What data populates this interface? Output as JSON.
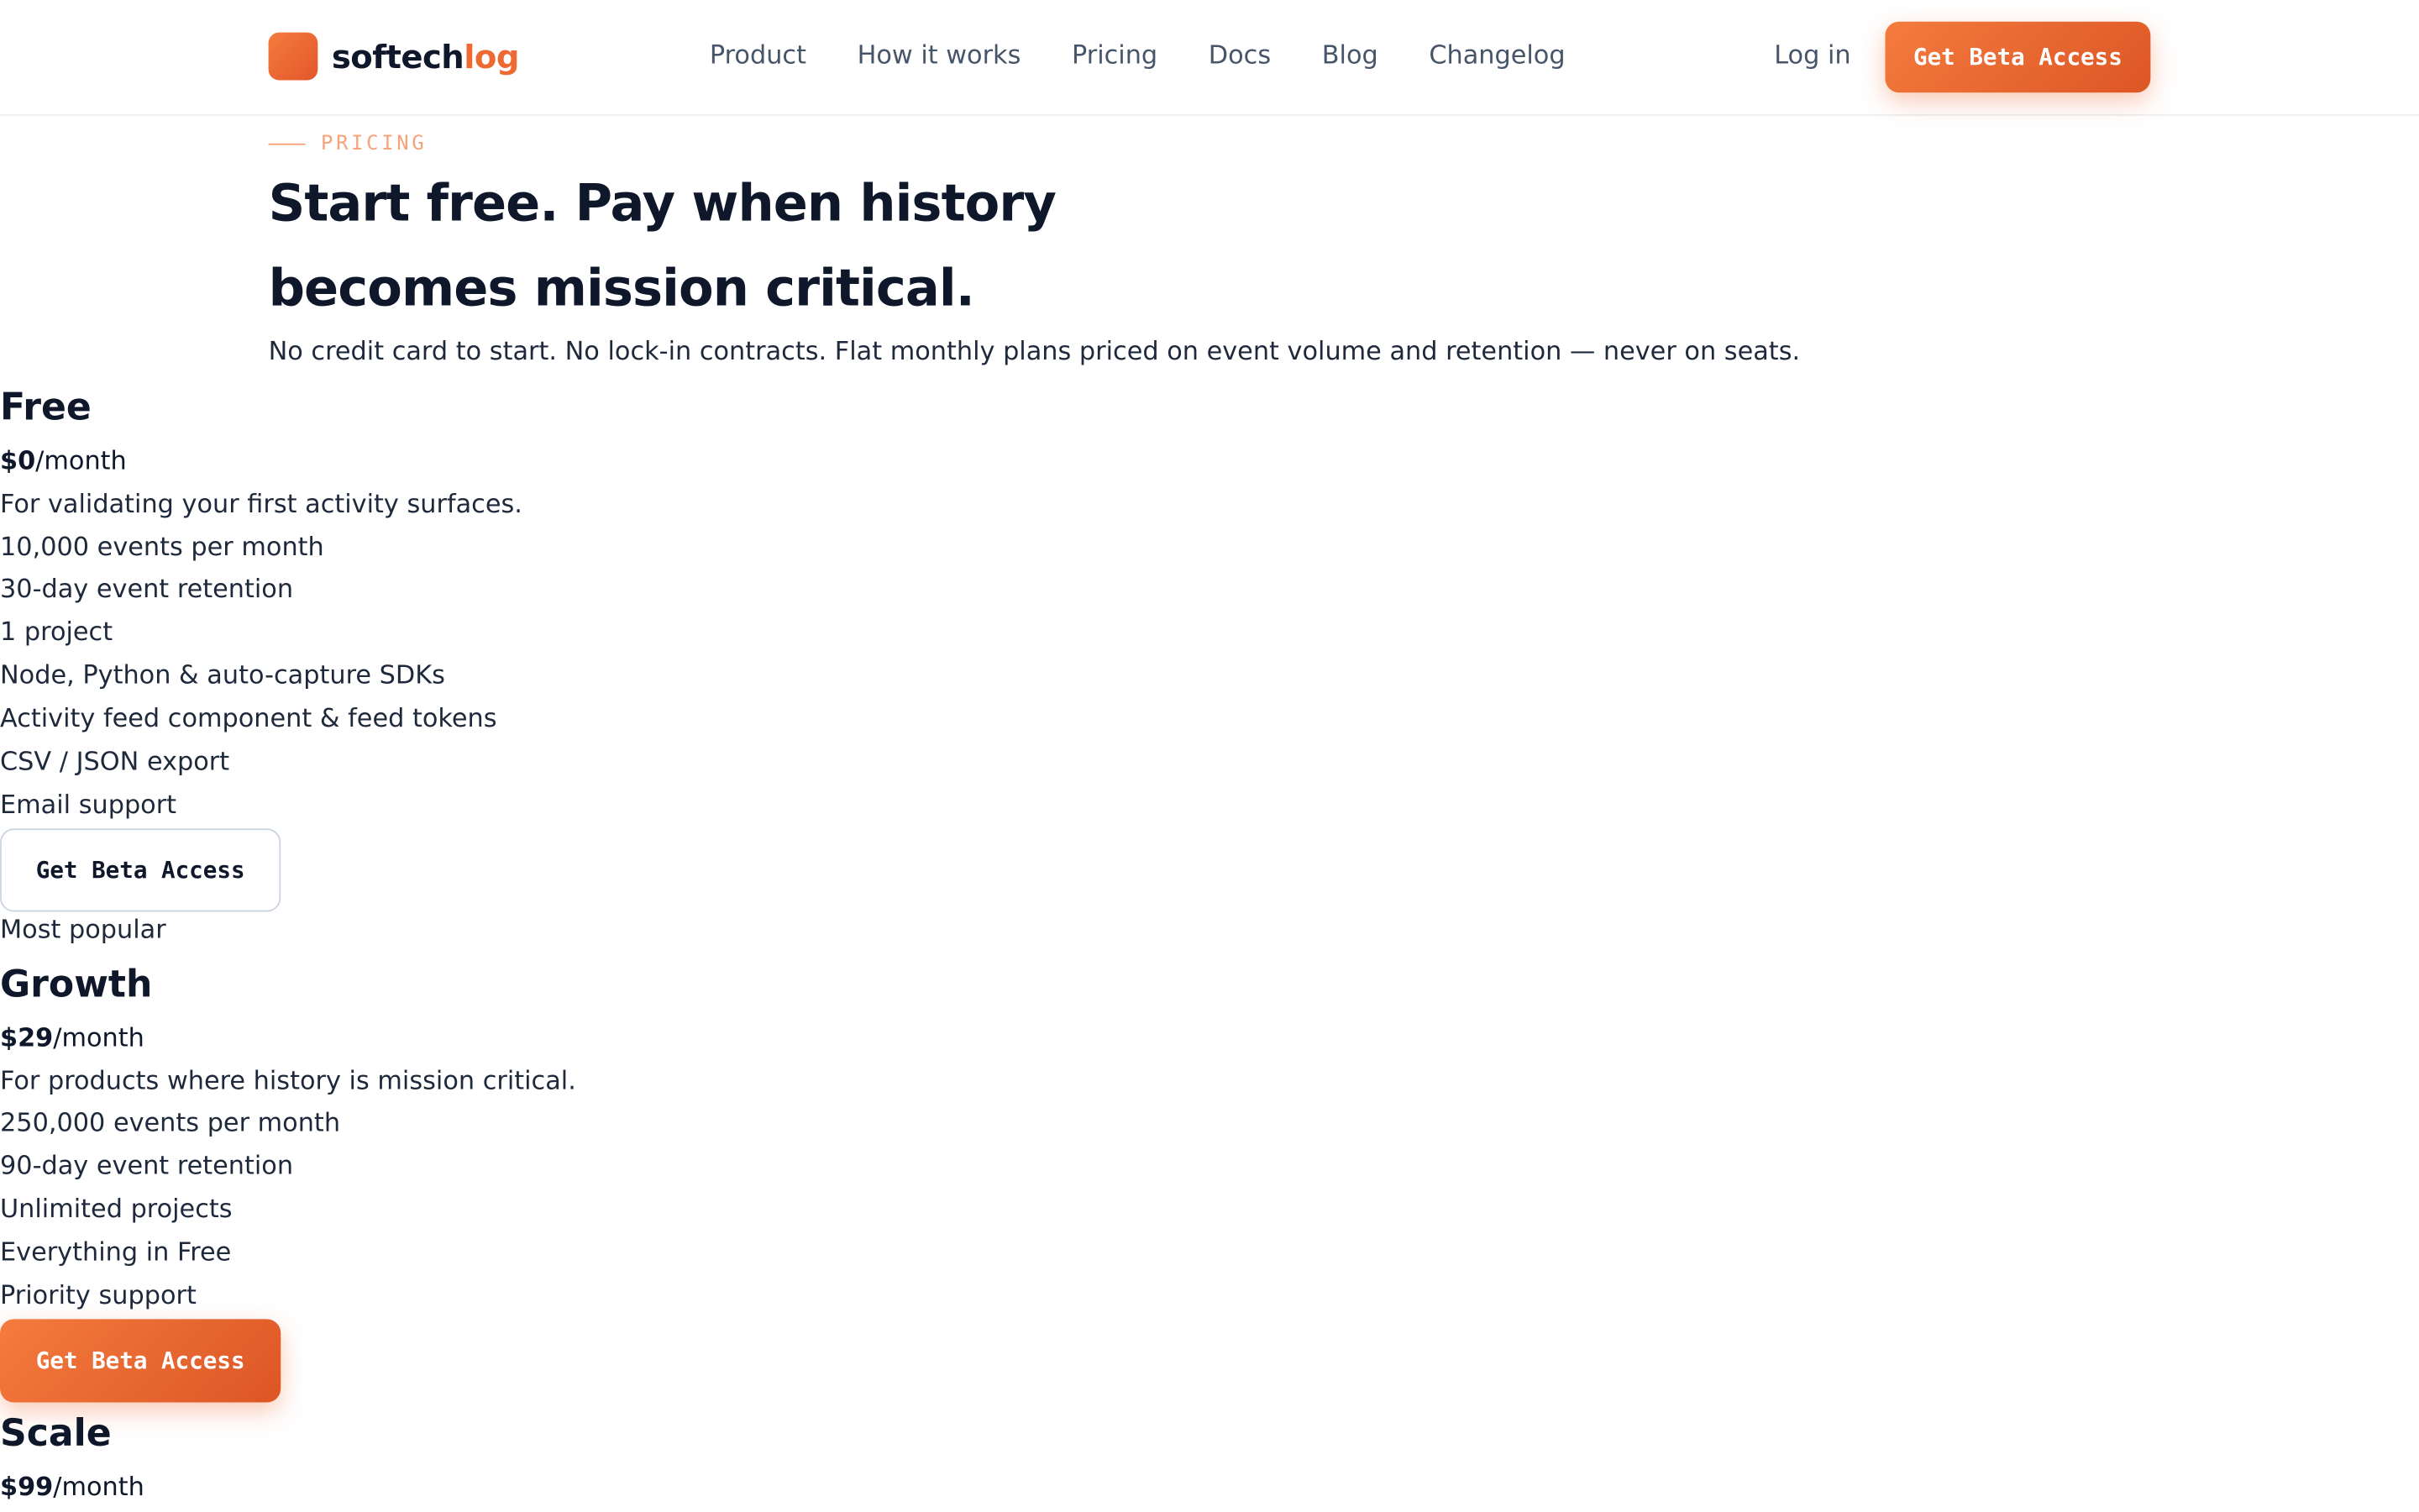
{
  "header": {
    "logo_main": "softech",
    "logo_accent": "log",
    "nav": [
      "Product",
      "How it works",
      "Pricing",
      "Docs",
      "Blog",
      "Changelog"
    ],
    "login": "Log in",
    "cta": "Get Beta Access"
  },
  "hero": {
    "eyebrow": "PRICING",
    "title": "Start free. Pay when history becomes mission critical.",
    "subtitle": "No credit card to start. No lock-in contracts. Flat monthly plans priced on event volume and retention — never on seats."
  },
  "plans": [
    {
      "name": "Free",
      "price": "$0",
      "period": "/month",
      "description": "For validating your first activity surfaces.",
      "features": [
        "10,000 events per month",
        "30-day event retention",
        "1 project",
        "Node, Python & auto-capture SDKs",
        "Activity feed component & feed tokens",
        "CSV / JSON export",
        "Email support"
      ],
      "cta": "Get Beta Access"
    },
    {
      "badge": "Most popular",
      "name": "Growth",
      "price": "$29",
      "period": "/month",
      "description": "For products where history is mission critical.",
      "features": [
        "250,000 events per month",
        "90-day event retention",
        "Unlimited projects",
        "Everything in Free",
        "Priority support"
      ],
      "cta": "Get Beta Access"
    },
    {
      "name": "Scale",
      "price": "$99",
      "period": "/month"
    }
  ],
  "colors": {
    "accent": "#ee6a32",
    "text": "#0f172a",
    "muted": "#475569"
  }
}
